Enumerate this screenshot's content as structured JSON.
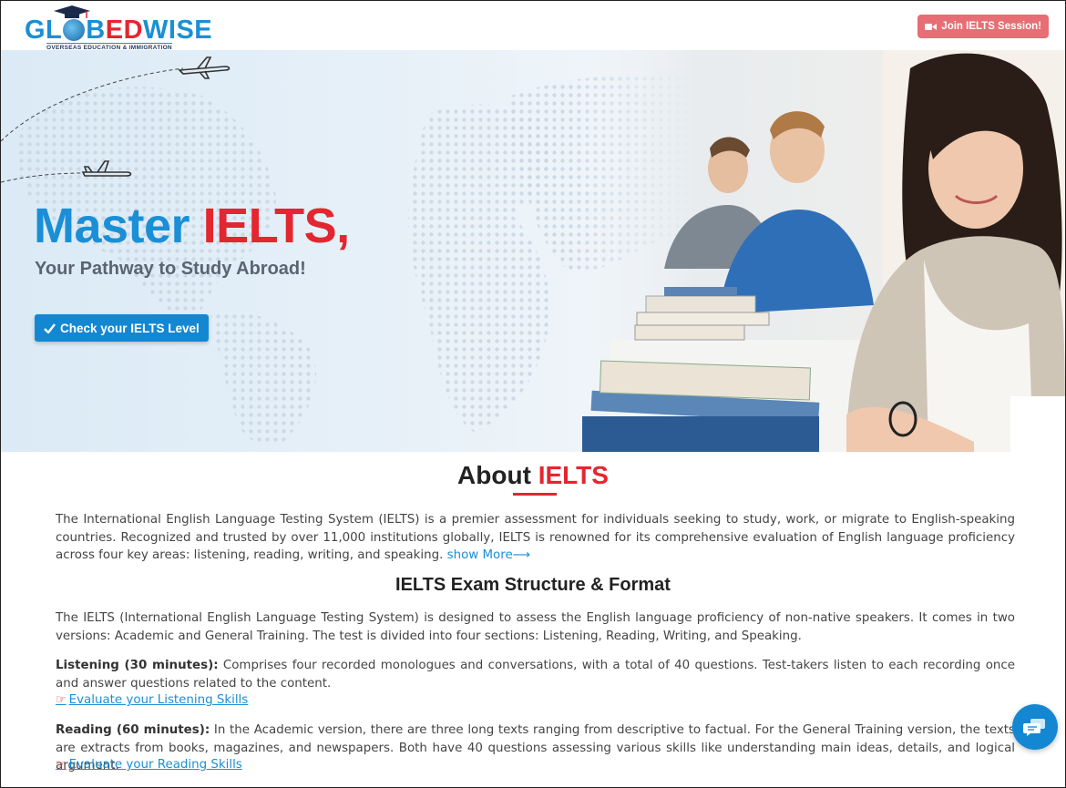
{
  "header": {
    "logo": {
      "part1": "GL",
      "part2": "B",
      "ed": "ED",
      "wise": "WISE",
      "tagline": "OVERSEAS EDUCATION & IMMIGRATION"
    },
    "join_button": "Join IELTS Session!",
    "join_icon": "video-camera-icon"
  },
  "hero": {
    "title_part1": "Master",
    "title_part2": "IELTS,",
    "subtitle": "Your Pathway to Study Abroad!",
    "cta_button": "Check your IELTS Level",
    "cta_icon": "checkmark-icon"
  },
  "about": {
    "title_part1": "About",
    "title_part2": "IELTS",
    "paragraph": "The International English Language Testing System (IELTS) is a premier assessment for individuals seeking to study, work, or migrate to English-speaking countries. Recognized and trusted by over 11,000 institutions globally, IELTS is renowned for its comprehensive evaluation of English language proficiency across four key areas: listening, reading, writing, and speaking.",
    "show_more": "show More⟶"
  },
  "structure": {
    "title": "IELTS Exam Structure & Format",
    "intro": "The IELTS (International English Language Testing System) is designed to assess the English language proficiency of non-native speakers. It comes in two versions: Academic and General Training. The test is divided into four sections: Listening, Reading, Writing, and Speaking.",
    "sections": [
      {
        "label": "Listening (30 minutes):",
        "text": " Comprises four recorded monologues and conversations, with a total of 40 questions. Test-takers listen to each recording once and answer questions related to the content.",
        "link": "Evaluate your Listening Skills"
      },
      {
        "label": "Reading (60 minutes):",
        "text": " In the Academic version, there are three long texts ranging from descriptive to factual. For the General Training version, the texts are extracts from books, magazines, and newspapers. Both have 40 questions assessing various skills like understanding main ideas, details, and logical argument.",
        "link": "Evaluate your Reading Skills"
      }
    ]
  },
  "colors": {
    "brand_blue": "#1a8fd6",
    "brand_red": "#e3262f",
    "join_button": "#e66e74"
  }
}
